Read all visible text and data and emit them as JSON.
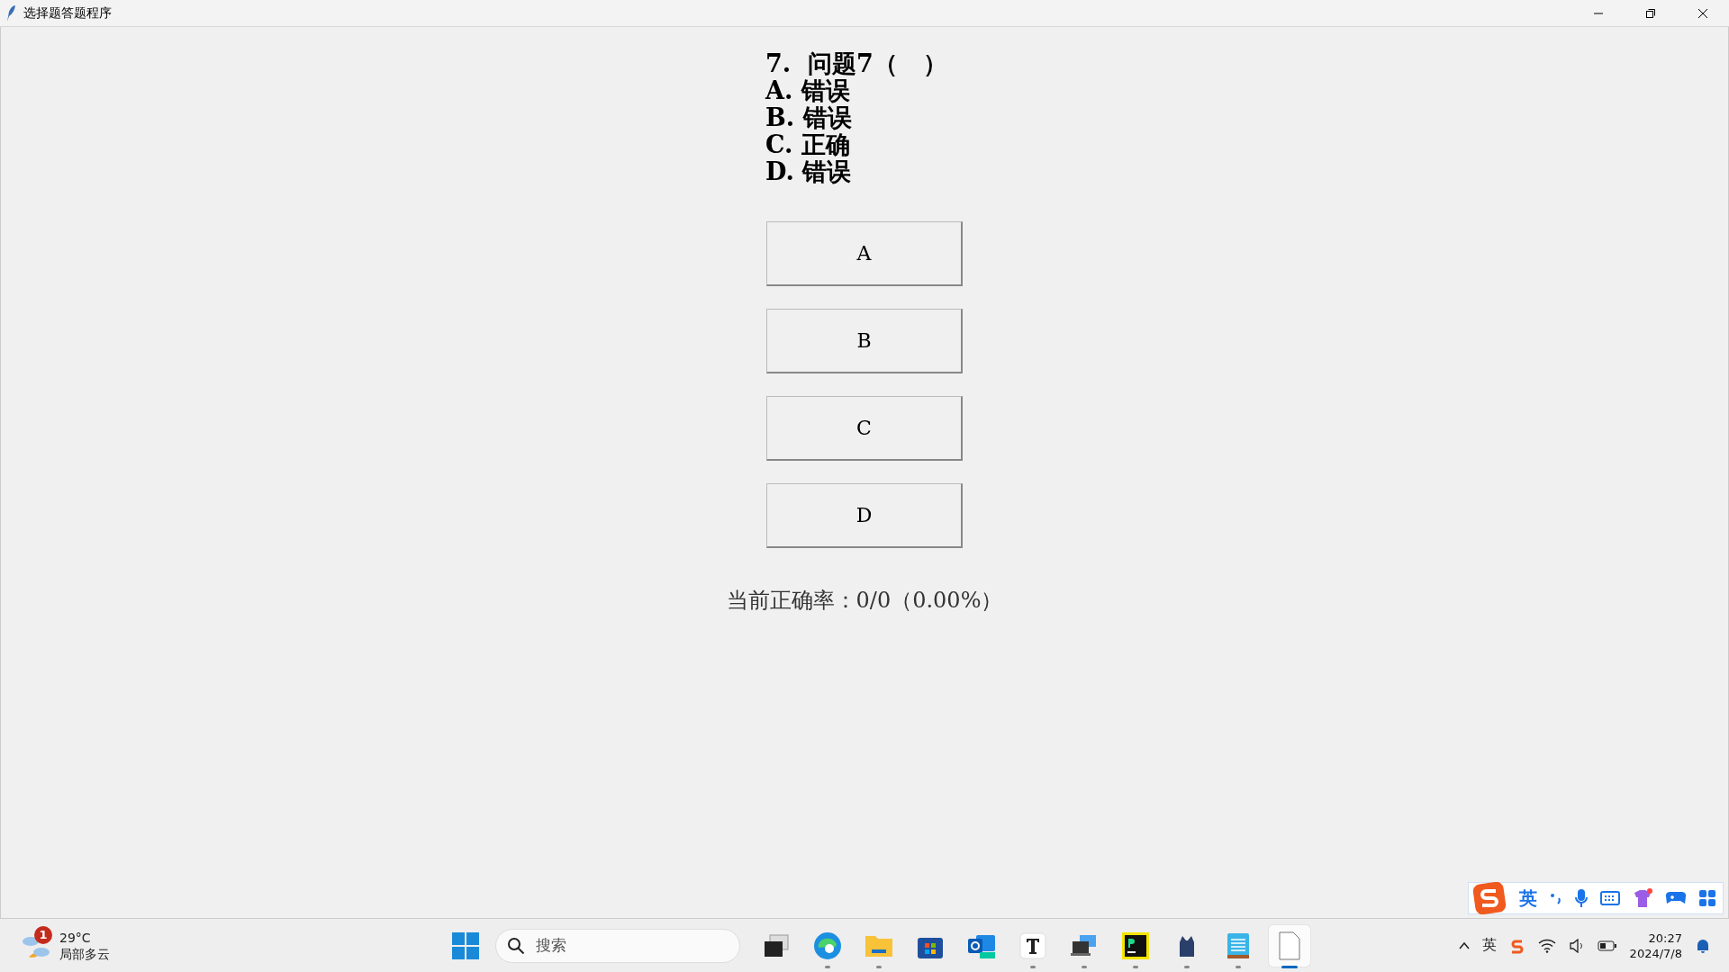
{
  "window": {
    "title": "选择题答题程序"
  },
  "question": {
    "title": "7.  问题7（   ）",
    "options": [
      "A. 错误",
      "B. 错误",
      "C. 正确",
      "D. 错误"
    ]
  },
  "answer_buttons": [
    "A",
    "B",
    "C",
    "D"
  ],
  "accuracy": "当前正确率：0/0（0.00%）",
  "ime_toolbar": {
    "mode": "英"
  },
  "taskbar": {
    "weather": {
      "badge": "1",
      "temperature": "29°C",
      "condition": "局部多云"
    },
    "search": {
      "placeholder": "搜索"
    },
    "apps": [
      {
        "kind": "taskview",
        "running": false,
        "active": false
      },
      {
        "kind": "browser",
        "running": true,
        "active": false
      },
      {
        "kind": "folder",
        "running": true,
        "active": false
      },
      {
        "kind": "store",
        "running": false,
        "active": false
      },
      {
        "kind": "mail",
        "running": false,
        "active": false
      },
      {
        "kind": "typora",
        "running": true,
        "active": false
      },
      {
        "kind": "remote",
        "running": true,
        "active": false
      },
      {
        "kind": "pycharm",
        "running": true,
        "active": false
      },
      {
        "kind": "cat",
        "running": true,
        "active": false
      },
      {
        "kind": "notepad",
        "running": true,
        "active": false
      },
      {
        "kind": "document",
        "running": true,
        "active": true
      }
    ],
    "tray": {
      "language": "英",
      "time": "20:27",
      "date": "2024/7/8"
    }
  }
}
